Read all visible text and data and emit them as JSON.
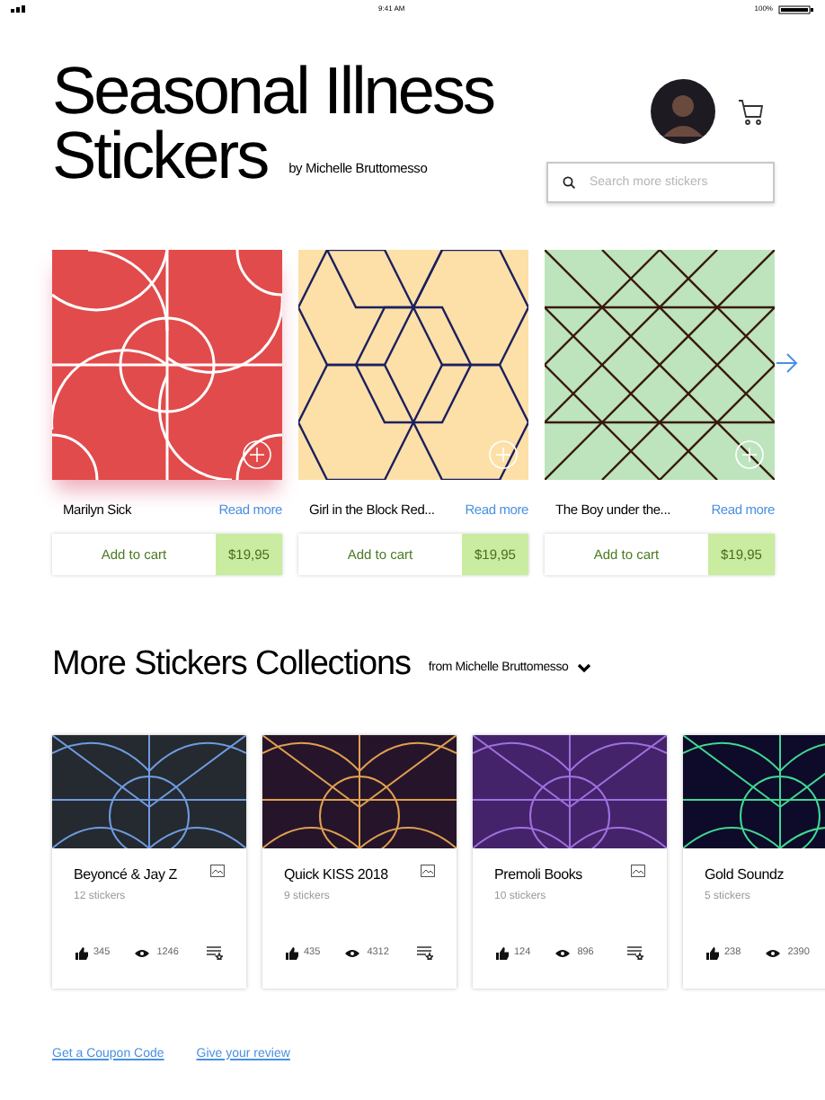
{
  "status_bar": {
    "time": "9:41 AM",
    "battery": "100%"
  },
  "header": {
    "title_lines": [
      "Seasonal Illness",
      "Stickers"
    ],
    "byline": "by Michelle Bruttomesso",
    "search": {
      "placeholder": "Search more stickers"
    }
  },
  "stickers": [
    {
      "name": "Marilyn Sick",
      "link": "Read more",
      "button": "Add to cart",
      "price": "$19,95",
      "kind": "arcs",
      "color": "#e24b4b",
      "highlighted": true
    },
    {
      "name": "Girl in the Block Red...",
      "link": "Read more",
      "button": "Add to cart",
      "price": "$19,95",
      "kind": "hexagons",
      "color": "#fde0a8",
      "highlighted": false
    },
    {
      "name": "The Boy under the...",
      "link": "Read more",
      "button": "Add to cart",
      "price": "$19,95",
      "kind": "lattice",
      "color": "#bde4bd",
      "highlighted": false
    }
  ],
  "collections_section": {
    "title": "More Stickers Collections",
    "filter": "from Michelle Bruttomesso"
  },
  "collections": [
    {
      "name": "Beyoncé & Jay Z",
      "count": "12 stickers",
      "likes": "345",
      "views": "1246",
      "color": "#252a30"
    },
    {
      "name": "Quick KISS 2018",
      "count": "9 stickers",
      "likes": "435",
      "views": "4312",
      "color": "#26152a"
    },
    {
      "name": "Premoli Books",
      "count": "10 stickers",
      "likes": "124",
      "views": "896",
      "color": "#45236a"
    },
    {
      "name": "Gold Soundz",
      "count": "5 stickers",
      "likes": "238",
      "views": "2390",
      "color": "#0e0a2a"
    }
  ],
  "footer_links": [
    "Get a Coupon Code",
    "Give your review"
  ]
}
